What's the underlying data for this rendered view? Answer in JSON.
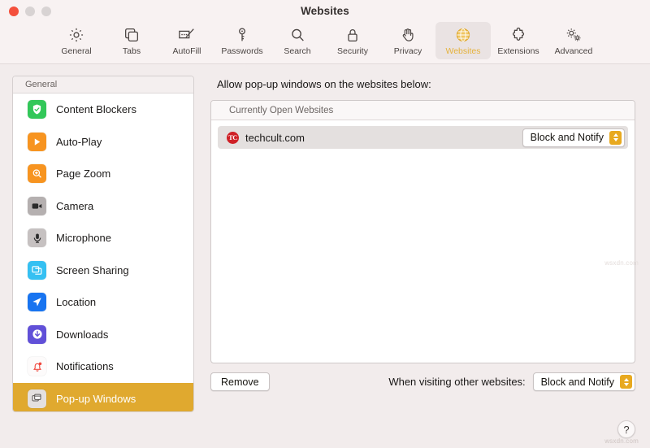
{
  "window": {
    "title": "Websites",
    "traffic_lights": [
      "close",
      "minimize",
      "zoom"
    ]
  },
  "toolbar": {
    "items": [
      {
        "label": "General",
        "icon": "gear-icon",
        "selected": false
      },
      {
        "label": "Tabs",
        "icon": "tabs-icon",
        "selected": false
      },
      {
        "label": "AutoFill",
        "icon": "autofill-icon",
        "selected": false
      },
      {
        "label": "Passwords",
        "icon": "key-icon",
        "selected": false
      },
      {
        "label": "Search",
        "icon": "magnifier-icon",
        "selected": false
      },
      {
        "label": "Security",
        "icon": "lock-icon",
        "selected": false
      },
      {
        "label": "Privacy",
        "icon": "hand-icon",
        "selected": false
      },
      {
        "label": "Websites",
        "icon": "globe-icon",
        "selected": true
      },
      {
        "label": "Extensions",
        "icon": "puzzle-icon",
        "selected": false
      },
      {
        "label": "Advanced",
        "icon": "gears-icon",
        "selected": false
      }
    ],
    "selected_accent": "#e5b23c"
  },
  "sidebar": {
    "header": "General",
    "selected_bg": "#e0a92f",
    "items": [
      {
        "label": "Content Blockers",
        "icon": "shield-check-icon",
        "selected": false
      },
      {
        "label": "Auto-Play",
        "icon": "play-icon",
        "selected": false
      },
      {
        "label": "Page Zoom",
        "icon": "zoom-in-icon",
        "selected": false
      },
      {
        "label": "Camera",
        "icon": "camera-icon",
        "selected": false
      },
      {
        "label": "Microphone",
        "icon": "microphone-icon",
        "selected": false
      },
      {
        "label": "Screen Sharing",
        "icon": "screen-share-icon",
        "selected": false
      },
      {
        "label": "Location",
        "icon": "location-icon",
        "selected": false
      },
      {
        "label": "Downloads",
        "icon": "download-icon",
        "selected": false
      },
      {
        "label": "Notifications",
        "icon": "bell-icon",
        "selected": false
      },
      {
        "label": "Pop-up Windows",
        "icon": "windows-icon",
        "selected": true
      }
    ]
  },
  "main": {
    "heading": "Allow pop-up windows on the websites below:",
    "list_header": "Currently Open Websites",
    "rows": [
      {
        "favicon_text": "TC",
        "favicon_color": "#cf2026",
        "site": "techcult.com",
        "setting": "Block and Notify"
      }
    ],
    "footer": {
      "remove_label": "Remove",
      "other_sites_label": "When visiting other websites:",
      "other_sites_value": "Block and Notify"
    }
  },
  "help": {
    "label": "?"
  },
  "watermarks": {
    "bottom_right": "wsxdn.com",
    "mid_right": "wsxdn.com"
  }
}
